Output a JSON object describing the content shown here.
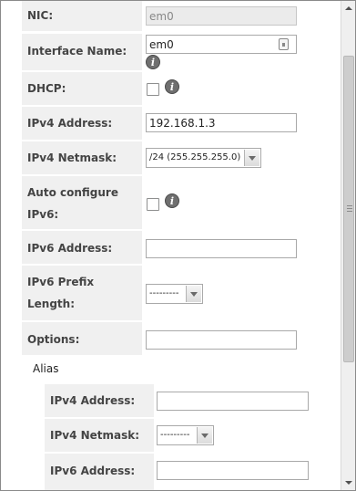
{
  "form": {
    "nic": {
      "label": "NIC:",
      "value": "em0"
    },
    "interface_name": {
      "label": "Interface Name:",
      "value": "em0"
    },
    "dhcp": {
      "label": "DHCP:",
      "checked": false
    },
    "ipv4_address": {
      "label": "IPv4 Address:",
      "value": "192.168.1.3"
    },
    "ipv4_netmask": {
      "label": "IPv4 Netmask:",
      "selected": "/24 (255.255.255.0)"
    },
    "auto_ipv6": {
      "label_line1": "Auto configure",
      "label_line2": "IPv6:",
      "checked": false
    },
    "ipv6_address": {
      "label": "IPv6 Address:",
      "value": ""
    },
    "ipv6_prefix": {
      "label_line1": "IPv6 Prefix",
      "label_line2": "Length:",
      "selected": "---------"
    },
    "options": {
      "label": "Options:",
      "value": ""
    }
  },
  "alias": {
    "heading": "Alias",
    "ipv4_address": {
      "label": "IPv4 Address:",
      "value": ""
    },
    "ipv4_netmask": {
      "label": "IPv4 Netmask:",
      "selected": "---------"
    },
    "ipv6_address": {
      "label": "IPv6 Address:",
      "value": ""
    }
  },
  "icons": {
    "info": "info-icon",
    "key": "key-icon"
  },
  "info_glyph": "i",
  "colors": {
    "label_bg": "#f0f0f0",
    "border": "#a9a9a9"
  }
}
